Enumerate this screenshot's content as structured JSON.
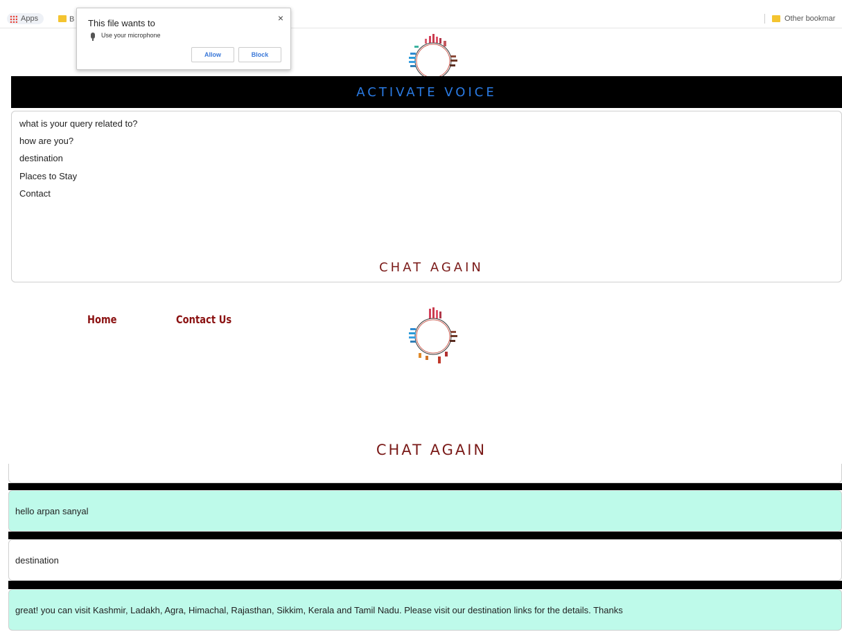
{
  "bookmarks": {
    "apps_label": "Apps",
    "folder1_label": "B",
    "other_label": "Other bookmar"
  },
  "permission": {
    "title": "This file wants to",
    "request": "Use your microphone",
    "allow_label": "Allow",
    "block_label": "Block",
    "close_glyph": "×"
  },
  "voice": {
    "label": "ACTIVATE VOICE"
  },
  "options": [
    "what is your query related to?",
    "how are you?",
    "destination",
    "Places to Stay",
    "Contact"
  ],
  "chat_again_label": "CHAT AGAIN",
  "nav": {
    "home": "Home",
    "contact": "Contact Us"
  },
  "messages": [
    {
      "from": "bot",
      "text": "hello arpan sanyal"
    },
    {
      "from": "user",
      "text": "destination"
    },
    {
      "from": "bot",
      "text": "great! you can visit Kashmir, Ladakh, Agra, Himachal, Rajasthan, Sikkim, Kerala and Tamil Nadu. Please visit our destination links for the details. Thanks"
    }
  ],
  "colors": {
    "voice_text": "#2a7be4",
    "chat_again": "#7a1a18",
    "nav": "#8b1212",
    "bot_bubble": "#befaea"
  }
}
